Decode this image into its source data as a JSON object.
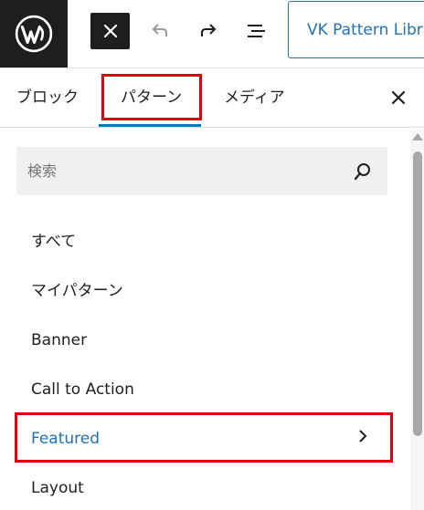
{
  "toolbar": {
    "logo_icon": "wordpress-logo",
    "close_icon": "close-icon",
    "undo_icon": "undo-icon",
    "redo_icon": "redo-icon",
    "list_view_icon": "list-view-icon",
    "document_title": "VK Pattern Library"
  },
  "tabs": [
    {
      "label": "ブロック"
    },
    {
      "label": "パターン"
    },
    {
      "label": "メディア"
    }
  ],
  "search": {
    "placeholder": "検索",
    "icon": "search-icon"
  },
  "categories": [
    {
      "label": "すべて"
    },
    {
      "label": "マイパターン"
    },
    {
      "label": "Banner"
    },
    {
      "label": "Call to Action"
    },
    {
      "label": "Featured"
    },
    {
      "label": "Layout"
    }
  ],
  "colors": {
    "accent": "#2271b1",
    "highlight": "#e3000f",
    "dark": "#1e1e1e"
  }
}
